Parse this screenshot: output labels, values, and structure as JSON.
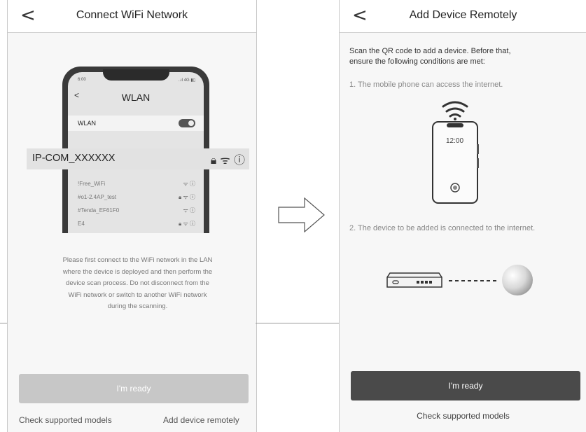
{
  "left_screen": {
    "title": "Connect WiFi Network",
    "phone": {
      "status_time": "6:00",
      "status_right": "..ıl 4G ▮▯",
      "back": "<",
      "title": "WLAN",
      "wlan_label": "WLAN",
      "networks": [
        {
          "name": "!Free_WiFi",
          "icons": "ᯤ ⓘ"
        },
        {
          "name": "#o1-2.4AP_test",
          "icons": "🔒︎ ᯤ ⓘ"
        },
        {
          "name": "#Tenda_EF61F0",
          "icons": "ᯤ ⓘ"
        },
        {
          "name": "E4",
          "icons": "🔒︎ ᯤ ⓘ"
        }
      ]
    },
    "highlighted_network": "IP-COM_XXXXXX",
    "highlighted_icons": "🔒︎ ᯤ ⓘ",
    "instruction_lines": [
      "Please first connect to the WiFi network in the LAN",
      "where the device is deployed and then perform the",
      "device scan process. Do not disconnect from the",
      "WiFi network or switch to another WiFi network",
      "during the scanning."
    ],
    "ready_button": "I'm ready",
    "check_models_link": "Check supported models",
    "add_remote_link": "Add device remotely"
  },
  "right_screen": {
    "title": "Add Device Remotely",
    "intro_line1": "Scan the QR code to add a device. Before that,",
    "intro_line2": "ensure the following conditions are met:",
    "condition1": "1. The mobile phone can access the internet.",
    "phone_time": "12:00",
    "condition2": "2. The device to be added is connected to the internet.",
    "ready_button": "I'm ready",
    "check_models_link": "Check supported models"
  },
  "back_symbol": "<"
}
